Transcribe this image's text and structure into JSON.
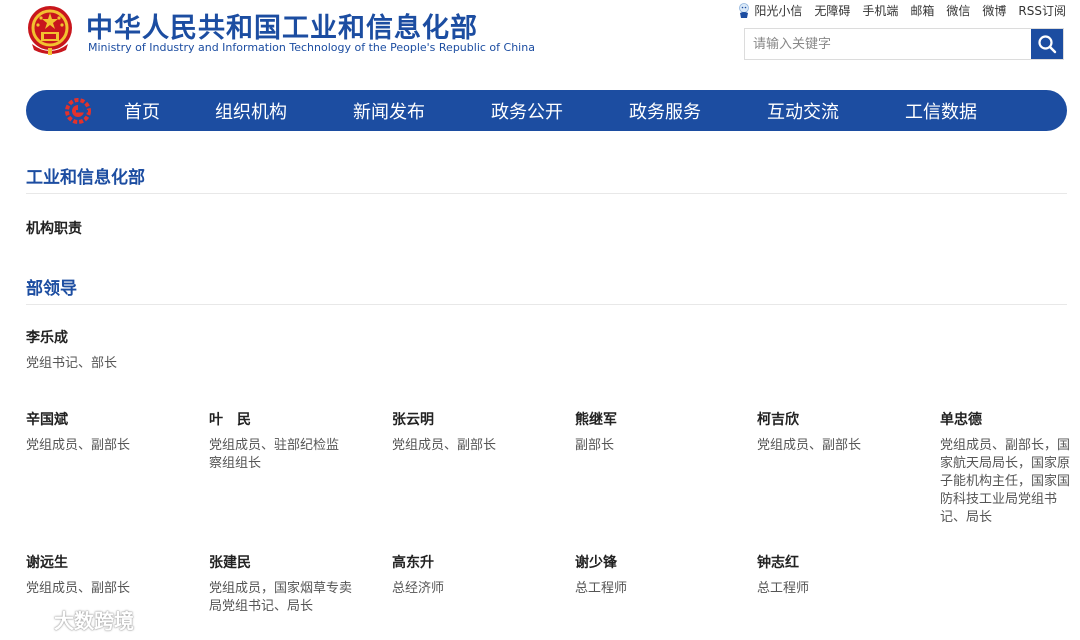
{
  "header": {
    "title": "中华人民共和国工业和信息化部",
    "subtitle": "Ministry of Industry and Information Technology of the People's Republic of China",
    "top_links": [
      "阳光小信",
      "无障碍",
      "手机端",
      "邮箱",
      "微信",
      "微博",
      "RSS订阅"
    ],
    "search_placeholder": "请输入关键字"
  },
  "nav": {
    "items": [
      "首页",
      "组织机构",
      "新闻发布",
      "政务公开",
      "政务服务",
      "互动交流",
      "工信数据"
    ]
  },
  "content": {
    "section1_title": "工业和信息化部",
    "section1_link": "机构职责",
    "section2_title": "部领导",
    "leaders": [
      {
        "name": "李乐成",
        "role": "党组书记、部长"
      },
      {
        "name": "辛国斌",
        "role": "党组成员、副部长"
      },
      {
        "name": "叶　民",
        "role": "党组成员、驻部纪检监察组组长"
      },
      {
        "name": "张云明",
        "role": "党组成员、副部长"
      },
      {
        "name": "熊继军",
        "role": "副部长"
      },
      {
        "name": "柯吉欣",
        "role": "党组成员、副部长"
      },
      {
        "name": "单忠德",
        "role": "党组成员、副部长，国家航天局局长，国家原子能机构主任，国家国防科技工业局党组书记、局长"
      },
      {
        "name": "谢远生",
        "role": "党组成员、副部长"
      },
      {
        "name": "张建民",
        "role": "党组成员，国家烟草专卖局党组书记、局长"
      },
      {
        "name": "高东升",
        "role": "总经济师"
      },
      {
        "name": "谢少锋",
        "role": "总工程师"
      },
      {
        "name": "钟志红",
        "role": "总工程师"
      }
    ]
  },
  "watermark": {
    "text": "大数跨境"
  },
  "colors": {
    "brand_blue": "#1c4da1",
    "text_dark": "#222222",
    "text_gray": "#555555"
  }
}
